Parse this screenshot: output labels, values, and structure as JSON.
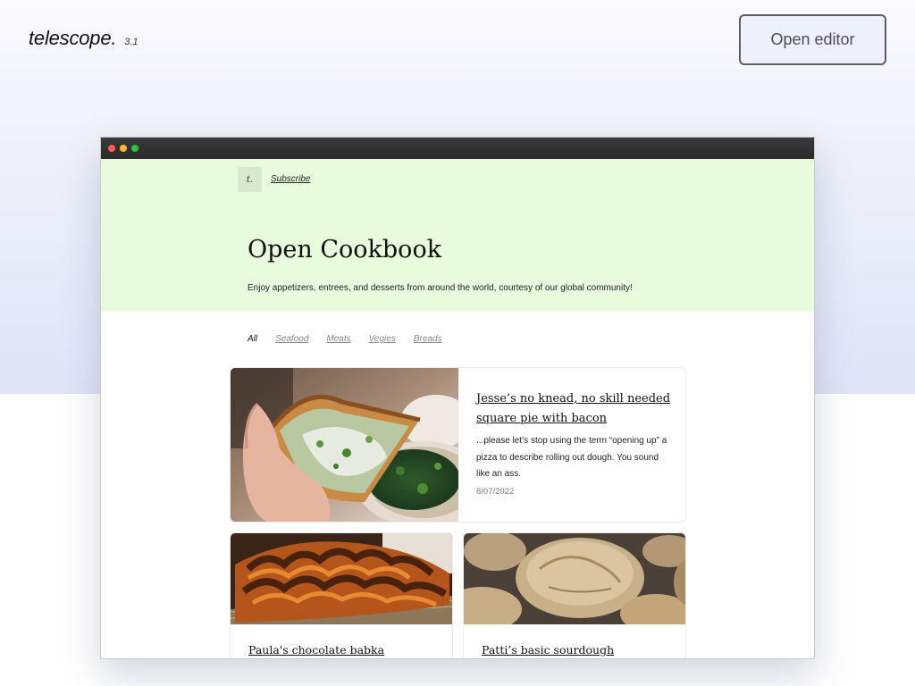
{
  "app": {
    "logo": "telescope.",
    "version": "3.1",
    "open_editor_label": "Open editor"
  },
  "browser_window": {
    "controls": [
      "close",
      "minimize",
      "maximize"
    ]
  },
  "site": {
    "logo_text": "t.",
    "subscribe_label": "Subscribe",
    "title": "Open Cookbook",
    "subtitle": "Enjoy appetizers, entrees, and desserts from around the world, courtesy of our global community!",
    "filters": [
      {
        "label": "All",
        "active": true
      },
      {
        "label": "Seafood",
        "active": false
      },
      {
        "label": "Meats",
        "active": false
      },
      {
        "label": "Vegies",
        "active": false
      },
      {
        "label": "Breads",
        "active": false
      }
    ],
    "featured": {
      "title": "Jesse’s no knead, no skill needed square pie with bacon",
      "excerpt": "...please let’s stop using the term “opening up” a pizza to describe rolling out dough. You sound like an ass.",
      "date": "8/07/2022",
      "image": "pizza-slice-photo"
    },
    "cards": [
      {
        "title": "Paula's chocolate babka",
        "image": "chocolate-babka-photo"
      },
      {
        "title": "Patti’s basic sourdough",
        "image": "sourdough-bread-photo"
      }
    ]
  },
  "colors": {
    "hero_bg": "#e8fbdc",
    "editor_button_border": "#5b5f69",
    "titlebar": "#2e2e2e"
  }
}
